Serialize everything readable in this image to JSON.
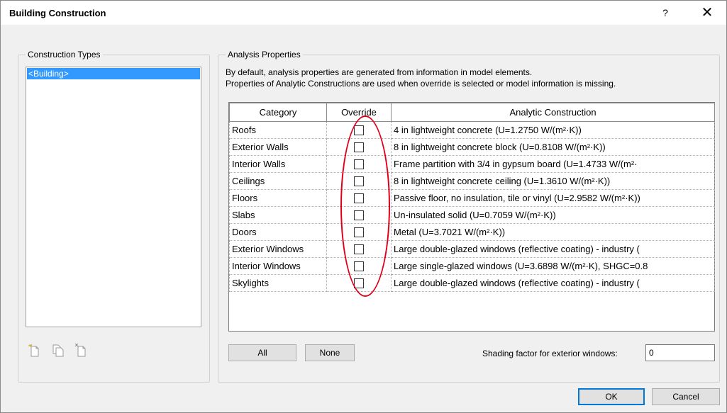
{
  "window": {
    "title": "Building Construction",
    "help_label": "?",
    "close_label": "✕"
  },
  "construction_types": {
    "label": "Construction Types",
    "items": [
      "<Building>"
    ],
    "selected_index": 0,
    "tools": [
      "new-icon",
      "duplicate-icon",
      "delete-icon"
    ]
  },
  "analysis": {
    "label": "Analysis Properties",
    "description_line1": "By default, analysis properties are generated from information in model elements.",
    "description_line2": "Properties of Analytic Constructions are used when override is selected or model information is missing.",
    "columns": [
      "Category",
      "Override",
      "Analytic Construction"
    ],
    "rows": [
      {
        "category": "Roofs",
        "override": false,
        "construction": "4 in lightweight concrete (U=1.2750 W/(m²·K))"
      },
      {
        "category": "Exterior Walls",
        "override": false,
        "construction": "8 in lightweight concrete block (U=0.8108 W/(m²·K))"
      },
      {
        "category": "Interior Walls",
        "override": false,
        "construction": "Frame partition with 3/4 in gypsum board (U=1.4733 W/(m²·"
      },
      {
        "category": "Ceilings",
        "override": false,
        "construction": "8 in lightweight concrete ceiling (U=1.3610 W/(m²·K))"
      },
      {
        "category": "Floors",
        "override": false,
        "construction": "Passive floor, no insulation, tile or vinyl (U=2.9582 W/(m²·K))"
      },
      {
        "category": "Slabs",
        "override": false,
        "construction": "Un-insulated solid (U=0.7059 W/(m²·K))"
      },
      {
        "category": "Doors",
        "override": false,
        "construction": "Metal (U=3.7021 W/(m²·K))"
      },
      {
        "category": "Exterior Windows",
        "override": false,
        "construction": "Large double-glazed windows (reflective coating) - industry ("
      },
      {
        "category": "Interior Windows",
        "override": false,
        "construction": "Large single-glazed windows (U=3.6898 W/(m²·K), SHGC=0.8"
      },
      {
        "category": "Skylights",
        "override": false,
        "construction": "Large double-glazed windows (reflective coating) - industry ("
      }
    ],
    "all_label": "All",
    "none_label": "None",
    "shading_label": "Shading factor for exterior windows:",
    "shading_value": "0"
  },
  "footer": {
    "ok_label": "OK",
    "cancel_label": "Cancel"
  },
  "colors": {
    "selection": "#3399ff",
    "annotation": "#e0001a",
    "dialog_bg": "#f0f0f0"
  }
}
